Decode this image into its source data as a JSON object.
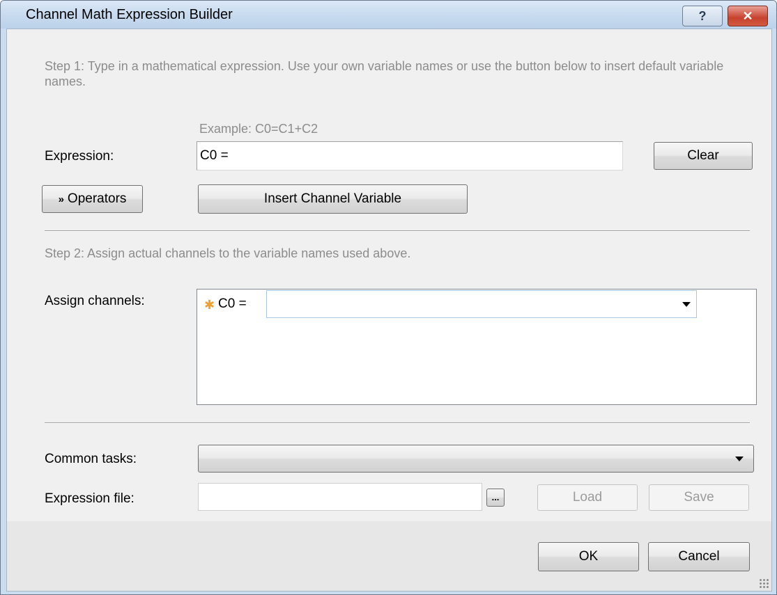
{
  "window": {
    "title": "Channel Math Expression Builder",
    "help_label": "?",
    "close_label": "✕"
  },
  "step1": {
    "text": "Step 1: Type in a mathematical expression. Use your own variable names or use the button below to insert default variable names.",
    "example": "Example: C0=C1+C2",
    "expression_label": "Expression:",
    "expression_value": "C0  =",
    "clear_label": "Clear",
    "operators_label": "Operators",
    "insert_label": "Insert Channel Variable"
  },
  "step2": {
    "text": "Step 2: Assign actual channels to the variable names used above.",
    "assign_label": "Assign channels:",
    "channels": [
      {
        "star": "✱",
        "name": "C0 =",
        "value": ""
      }
    ]
  },
  "bottom": {
    "common_tasks_label": "Common tasks:",
    "common_tasks_value": "",
    "expression_file_label": "Expression file:",
    "expression_file_value": "",
    "browse_label": "...",
    "load_label": "Load",
    "save_label": "Save"
  },
  "footer": {
    "ok_label": "OK",
    "cancel_label": "Cancel"
  }
}
